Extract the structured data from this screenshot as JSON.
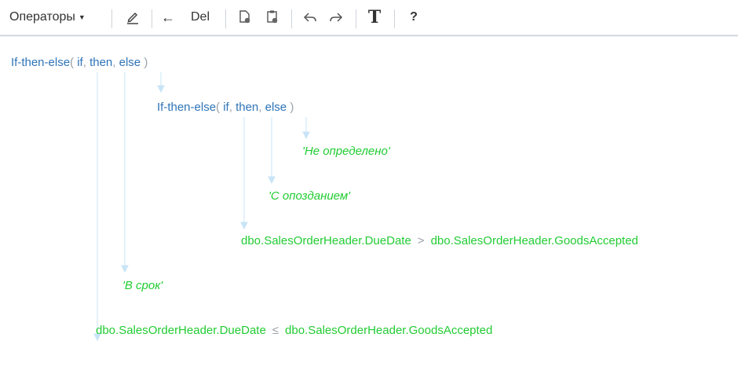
{
  "toolbar": {
    "operators_label": "Операторы",
    "back_arrow": "←",
    "delete_label": "Del",
    "text_label": "T",
    "help_label": "?"
  },
  "expressions": {
    "root": {
      "function": "If-then-else",
      "open": "(",
      "args": [
        "if",
        "then",
        "else"
      ],
      "sep": ",",
      "close": ")"
    },
    "nested": {
      "function": "If-then-else",
      "open": "(",
      "args": [
        "if",
        "then",
        "else"
      ],
      "sep": ",",
      "close": ")"
    },
    "nested_else_value": "'Не определено'",
    "nested_then_value": "'С опозданием'",
    "nested_condition": {
      "left": "dbo.SalesOrderHeader.DueDate",
      "operator": ">",
      "right": "dbo.SalesOrderHeader.GoodsAccepted"
    },
    "root_then_value": "'В срок'",
    "root_condition": {
      "left": "dbo.SalesOrderHeader.DueDate",
      "operator": "≤",
      "right": "dbo.SalesOrderHeader.GoodsAccepted"
    }
  },
  "colors": {
    "function": "#2f74b8",
    "literal": "#22cc33",
    "punctuation": "#9aa1a8",
    "connector": "#c8e4f7"
  }
}
